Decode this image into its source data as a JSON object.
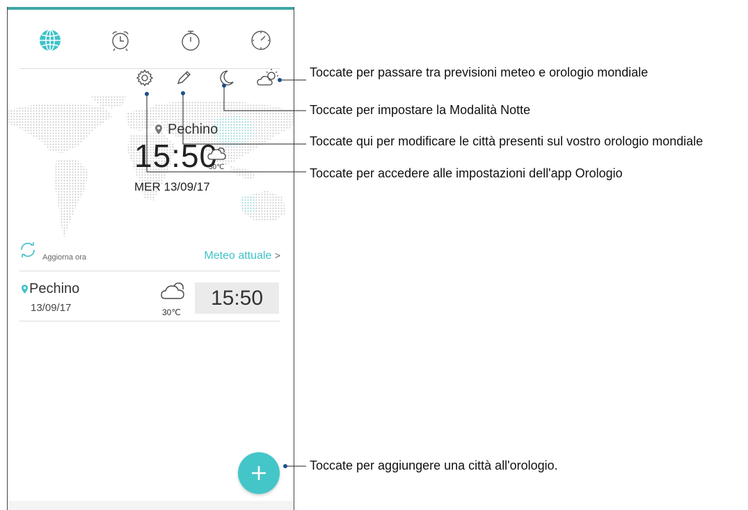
{
  "tabs": [
    {
      "name": "world-clock-globe-icon"
    },
    {
      "name": "alarm-icon"
    },
    {
      "name": "stopwatch-icon"
    },
    {
      "name": "timer-icon"
    }
  ],
  "top_icons": [
    "settings-icon",
    "pencil-icon",
    "night-mode-moon-icon",
    "weather-icon"
  ],
  "clock": {
    "city": "Pechino",
    "time": "15:50",
    "temp": "30℃",
    "date": "MER 13/09/17"
  },
  "refresh": {
    "label": "Aggiorna ora",
    "link": "Meteo attuale",
    "link_chevron": ">"
  },
  "city_list": [
    {
      "name": "Pechino",
      "date": "13/09/17",
      "temp": "30℃",
      "time": "15:50"
    }
  ],
  "fab_label": "+",
  "callouts": {
    "weather_toggle": "Toccate per passare tra previsioni meteo e orologio mondiale",
    "night_mode": "Toccate per impostare la Modalità Notte",
    "edit_cities": "Toccate qui per modificare le città presenti sul vostro orologio mondiale",
    "settings": "Toccate per accedere alle impostazioni dell'app Orologio",
    "add_city": "Toccate per aggiungere una città all'orologio."
  },
  "colors": {
    "accent": "#44c6c9",
    "link": "#3fc2c8",
    "topbar": "#3fa6a6",
    "callout_line": "#1c4f8c"
  }
}
